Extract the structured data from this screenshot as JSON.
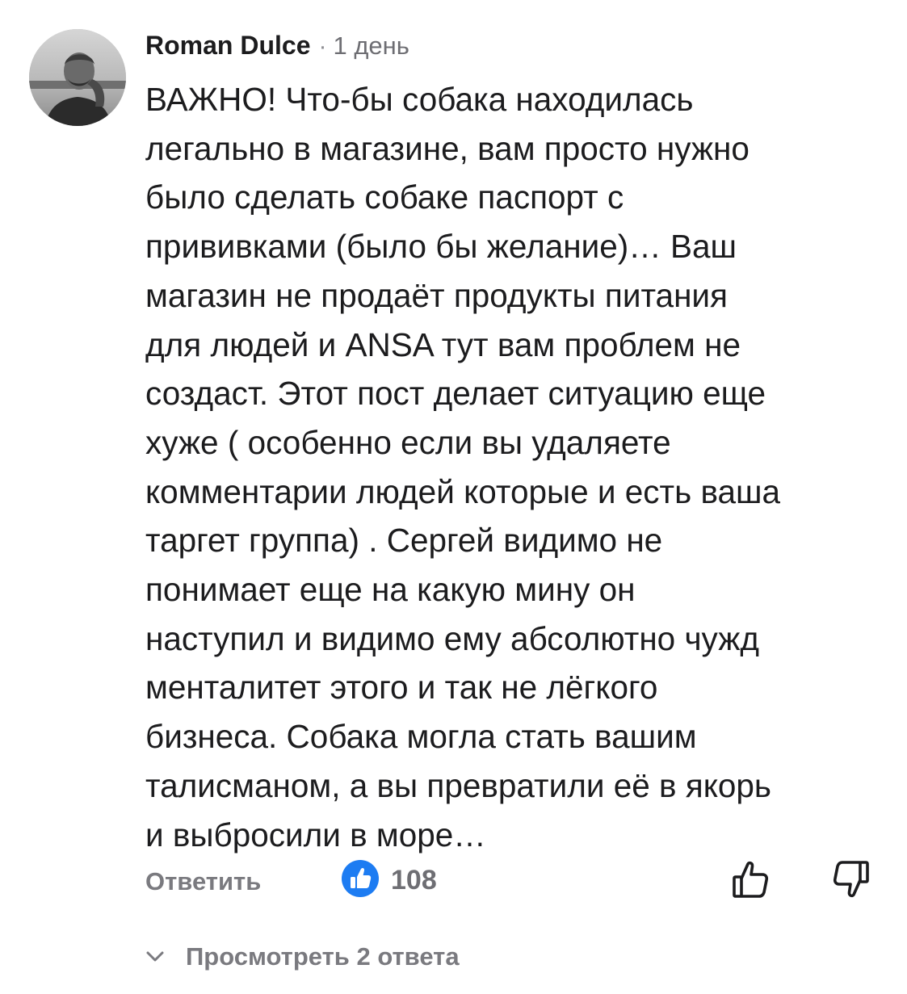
{
  "comment": {
    "author": "Roman Dulce",
    "separator": "·",
    "time": "1 день",
    "lines": [
      "ВАЖНО! Что-бы собака находилась",
      "легально в магазине, вам просто нужно",
      "было сделать собаке паспорт с",
      "прививками (было бы желание)… Ваш",
      "магазин не продаёт продукты питания",
      "для людей и ANSA тут вам проблем не",
      "создаст. Этот пост делает ситуацию еще",
      "хуже ( особенно если вы удаляете",
      "комментарии людей которые и есть ваша",
      "таргет группа) . Сергей видимо не",
      "понимает еще на какую мину он",
      "наступил и видимо ему абсолютно чужд",
      "менталитет этого и так не лёгкого",
      "бизнеса. Собака могла стать вашим",
      "талисманом, а вы превратили её в якорь",
      "и выбросили в море…"
    ]
  },
  "actions": {
    "reply_label": "Ответить",
    "like_count": "108",
    "like_icon": "like-icon",
    "thumb_up_icon": "thumbs-up-icon",
    "thumb_down_icon": "thumbs-down-icon"
  },
  "replies": {
    "view_label": "Просмотреть 2 ответа",
    "chevron_icon": "chevron-down-icon"
  },
  "colors": {
    "like_blue": "#1d7cf2",
    "text_primary": "#1c1c1e",
    "text_secondary": "#7a7a7f"
  }
}
